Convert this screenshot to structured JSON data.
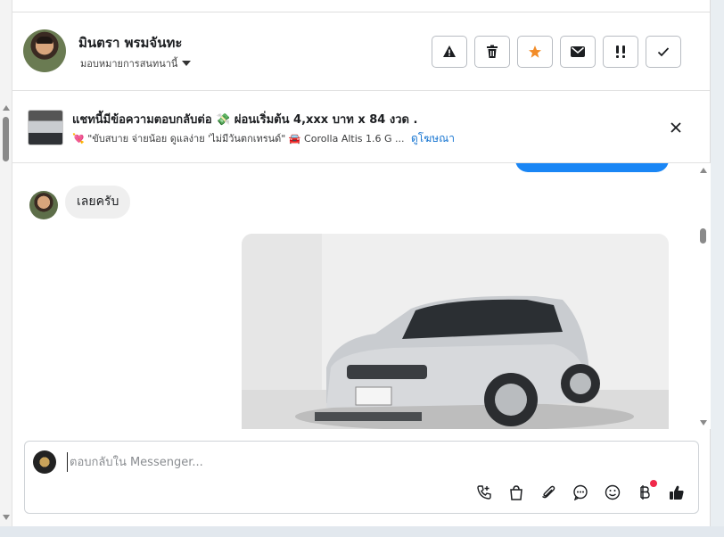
{
  "contact": {
    "name": "มินตรา พรมจันทะ",
    "assign_label": "มอบหมายการสนทนานี้"
  },
  "header_actions": [
    {
      "icon": "warning-icon",
      "label": "Mark as spam"
    },
    {
      "icon": "trash-icon",
      "label": "Delete"
    },
    {
      "icon": "star-icon",
      "label": "Star"
    },
    {
      "icon": "mail-icon",
      "label": "Mark as unread"
    },
    {
      "icon": "follow-up-icon",
      "label": "Follow up"
    },
    {
      "icon": "check-icon",
      "label": "Mark as done"
    }
  ],
  "ad": {
    "title": "แชทนี้มีข้อความตอบกลับต่อ 💸 ผ่อนเริ่มต้น 4,xxx บาท x 84 งวด .",
    "subtitle": "💘 \"ขับสบาย จ่ายน้อย ดูแลง่าย 'ไม่มีวันตกเทรนด์\" 🚘 Corolla Altis 1.6 G ...",
    "link": "ดูโฆษณา"
  },
  "messages": {
    "incoming_text": "เลยครับ"
  },
  "composer": {
    "placeholder": "ตอบกลับใน Messenger..."
  },
  "composer_tools": [
    "call-icon",
    "bag-icon",
    "attach-icon",
    "saved-replies-icon",
    "emoji-icon",
    "baht-icon",
    "like-icon"
  ],
  "colors": {
    "accent_blue": "#1a86f5",
    "star": "#f28c28",
    "link": "#1876d2",
    "notification_dot": "#f0284a"
  }
}
